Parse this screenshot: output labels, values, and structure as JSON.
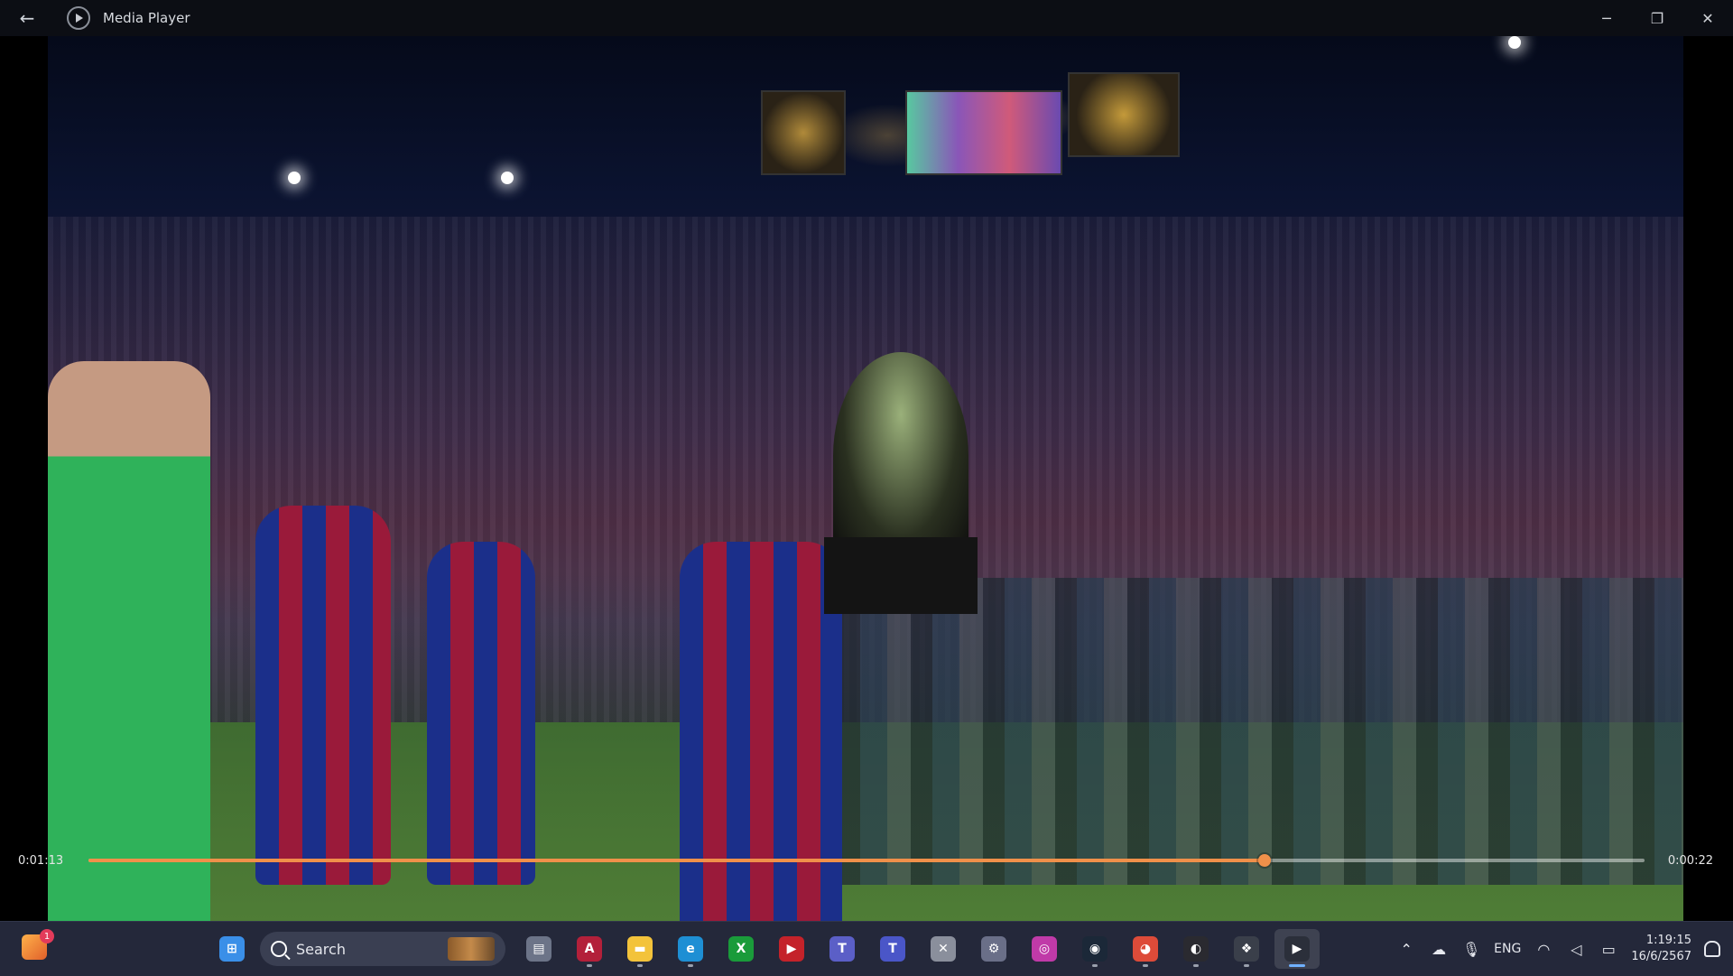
{
  "window": {
    "title": "Media Player",
    "back_icon": "back-arrow-icon",
    "controls": {
      "minimize": "─",
      "maximize": "❐",
      "close": "✕"
    }
  },
  "player": {
    "time_elapsed": "0:01:13",
    "time_remaining": "0:00:22",
    "progress_fraction": 0.756,
    "accent_color": "#f0904a"
  },
  "taskbar": {
    "search_placeholder": "Search",
    "weather_badge": "1",
    "apps": [
      {
        "name": "start",
        "icon": "windows-icon",
        "color": "#3a8fe8",
        "glyph": "⊞",
        "dot": false,
        "active": false
      },
      {
        "name": "task-view",
        "icon": "task-view-icon",
        "color": "#6c7488",
        "glyph": "▤",
        "dot": false,
        "active": false
      },
      {
        "name": "access",
        "icon": "access-icon",
        "color": "#b3203a",
        "glyph": "A",
        "dot": true,
        "active": false
      },
      {
        "name": "file-explorer",
        "icon": "folder-icon",
        "color": "#f3c33b",
        "glyph": "▬",
        "dot": true,
        "active": false
      },
      {
        "name": "edge",
        "icon": "edge-icon",
        "color": "#1e8fd4",
        "glyph": "e",
        "dot": true,
        "active": false
      },
      {
        "name": "xbox",
        "icon": "xbox-icon",
        "color": "#1a9b3a",
        "glyph": "X",
        "dot": false,
        "active": false
      },
      {
        "name": "game-app",
        "icon": "game-icon",
        "color": "#c4222a",
        "glyph": "▶",
        "dot": false,
        "active": false
      },
      {
        "name": "teams",
        "icon": "teams-icon",
        "color": "#5b5fc7",
        "glyph": "T",
        "dot": false,
        "active": false
      },
      {
        "name": "teams-new",
        "icon": "teams-new-icon",
        "color": "#4a56c8",
        "glyph": "T",
        "dot": false,
        "active": false
      },
      {
        "name": "tools",
        "icon": "tools-icon",
        "color": "#8a8f9c",
        "glyph": "✕",
        "dot": false,
        "active": false
      },
      {
        "name": "settings-app",
        "icon": "gear-icon",
        "color": "#6a6f88",
        "glyph": "⚙",
        "dot": false,
        "active": false
      },
      {
        "name": "photo-app",
        "icon": "camera-icon",
        "color": "#c03aa8",
        "glyph": "◎",
        "dot": false,
        "active": false
      },
      {
        "name": "steam",
        "icon": "steam-icon",
        "color": "#1b2838",
        "glyph": "◉",
        "dot": true,
        "active": false
      },
      {
        "name": "chrome",
        "icon": "chrome-icon",
        "color": "#dd4b39",
        "glyph": "◕",
        "dot": true,
        "active": false
      },
      {
        "name": "obs",
        "icon": "obs-icon",
        "color": "#2a2a30",
        "glyph": "◐",
        "dot": true,
        "active": false
      },
      {
        "name": "davinci",
        "icon": "davinci-icon",
        "color": "#3a3f4a",
        "glyph": "❖",
        "dot": true,
        "active": false
      },
      {
        "name": "media-player",
        "icon": "media-player-icon",
        "color": "#2b2f3a",
        "glyph": "▶",
        "dot": true,
        "active": true
      }
    ],
    "tray": {
      "language": "ENG",
      "time": "1:19:15",
      "date": "16/6/2567"
    }
  }
}
